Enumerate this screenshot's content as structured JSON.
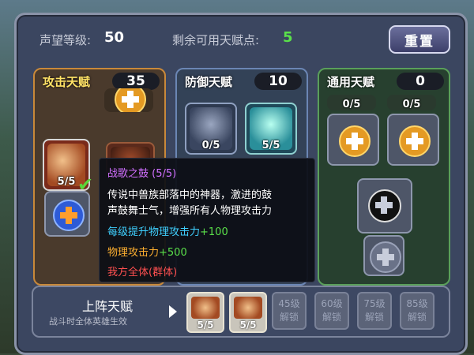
{
  "header": {
    "reputation_label": "声望等级:",
    "reputation_value": "50",
    "points_label": "剩余可用天赋点:",
    "points_value": "5",
    "reset_label": "重置"
  },
  "columns": {
    "attack": {
      "title": "攻击天赋",
      "count": "35"
    },
    "defense": {
      "title": "防御天赋",
      "count": "10"
    },
    "common": {
      "title": "通用天赋",
      "count": "0"
    }
  },
  "slots": {
    "attack_selected_level": "5/5",
    "defense_slot1_level": "0/5",
    "defense_slot2_level": "5/5",
    "common_slot1_level": "0/5",
    "common_slot2_level": "0/5"
  },
  "tooltip": {
    "name": "战歌之鼓 (5/5)",
    "desc_line1": "传说中兽族部落中的神器，激进的鼓",
    "desc_line2": "声鼓舞士气，增强所有人物理攻击力",
    "per_level_label": "每级提升物理攻击力",
    "per_level_value": "+100",
    "total_label": "物理攻击力",
    "total_value": "+500",
    "target": "我方全体(群体)"
  },
  "bottom": {
    "title": "上阵天赋",
    "subtitle": "战斗时全体英雄生效",
    "slot1_level": "5/5",
    "slot2_level": "5/5",
    "locks": [
      {
        "level": "45级",
        "text": "解锁"
      },
      {
        "level": "60级",
        "text": "解锁"
      },
      {
        "level": "75级",
        "text": "解锁"
      },
      {
        "level": "85级",
        "text": "解锁"
      }
    ]
  },
  "colors": {
    "attack_border": "#c9893a",
    "defense_border": "#6b86b4",
    "common_border": "#5aa05a",
    "points_green": "#5ae04a",
    "tooltip_purple": "#d070ff",
    "tooltip_cyan": "#3fd0ff",
    "tooltip_orange": "#ffb030",
    "tooltip_red": "#ff5050"
  }
}
